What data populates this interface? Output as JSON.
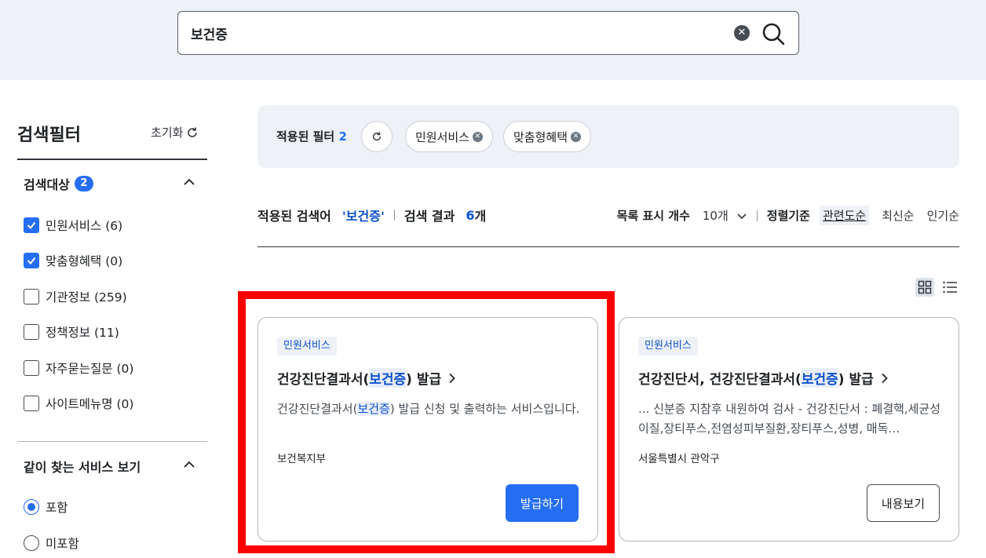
{
  "search": {
    "query": "보건증",
    "clear_icon": "close-circle-icon",
    "search_icon": "search-icon"
  },
  "sidebar": {
    "title": "검색필터",
    "reset_label": "초기화",
    "sections": [
      {
        "title": "검색대상",
        "badge": "2",
        "options": [
          {
            "label": "민원서비스 (6)",
            "checked": true
          },
          {
            "label": "맞춤형혜택 (0)",
            "checked": true
          },
          {
            "label": "기관정보 (259)",
            "checked": false
          },
          {
            "label": "정책정보 (11)",
            "checked": false
          },
          {
            "label": "자주묻는질문 (0)",
            "checked": false
          },
          {
            "label": "사이트메뉴명 (0)",
            "checked": false
          }
        ]
      },
      {
        "title": "같이 찾는 서비스 보기",
        "options": [
          {
            "label": "포함",
            "checked": true
          },
          {
            "label": "미포함",
            "checked": false
          }
        ]
      }
    ]
  },
  "applied": {
    "label": "적용된 필터",
    "count": "2",
    "chips": [
      "민원서비스",
      "맞춤형혜택"
    ]
  },
  "summary": {
    "query_label": "적용된 검색어",
    "query_value": "'보건증'",
    "result_label": "검색 결과",
    "result_count": "6",
    "result_unit": "개",
    "page_size_label": "목록 표시 개수",
    "page_size_value": "10개",
    "sort_label": "정렬기준",
    "sort_options": [
      "관련도순",
      "최신순",
      "인기순"
    ],
    "active_sort": "관련도순"
  },
  "cards": [
    {
      "tag": "민원서비스",
      "title_before": "건강진단결과서(",
      "title_highlight": "보건증",
      "title_after": ") 발급",
      "desc_before": "건강진단결과서(",
      "desc_highlight": "보건증",
      "desc_after": ") 발급 신청 및 출력하는 서비스입니다.",
      "org": "보건복지부",
      "action": "발급하기"
    },
    {
      "tag": "민원서비스",
      "title_before": "건강진단서, 건강진단결과서(",
      "title_highlight": "보건증",
      "title_after": ") 발급",
      "desc": "... 신분증 지참후 내원하여 검사 - 건강진단서 : 폐결핵,세균성이질,장티푸스,전염성피부질환,장티푸스,성병, 매독…",
      "org": "서울특별시 관악구",
      "action": "내용보기"
    }
  ],
  "colors": {
    "accent": "#256ef4",
    "highlight_text": "#0b50d0",
    "annotation_box": "#ff0000"
  }
}
